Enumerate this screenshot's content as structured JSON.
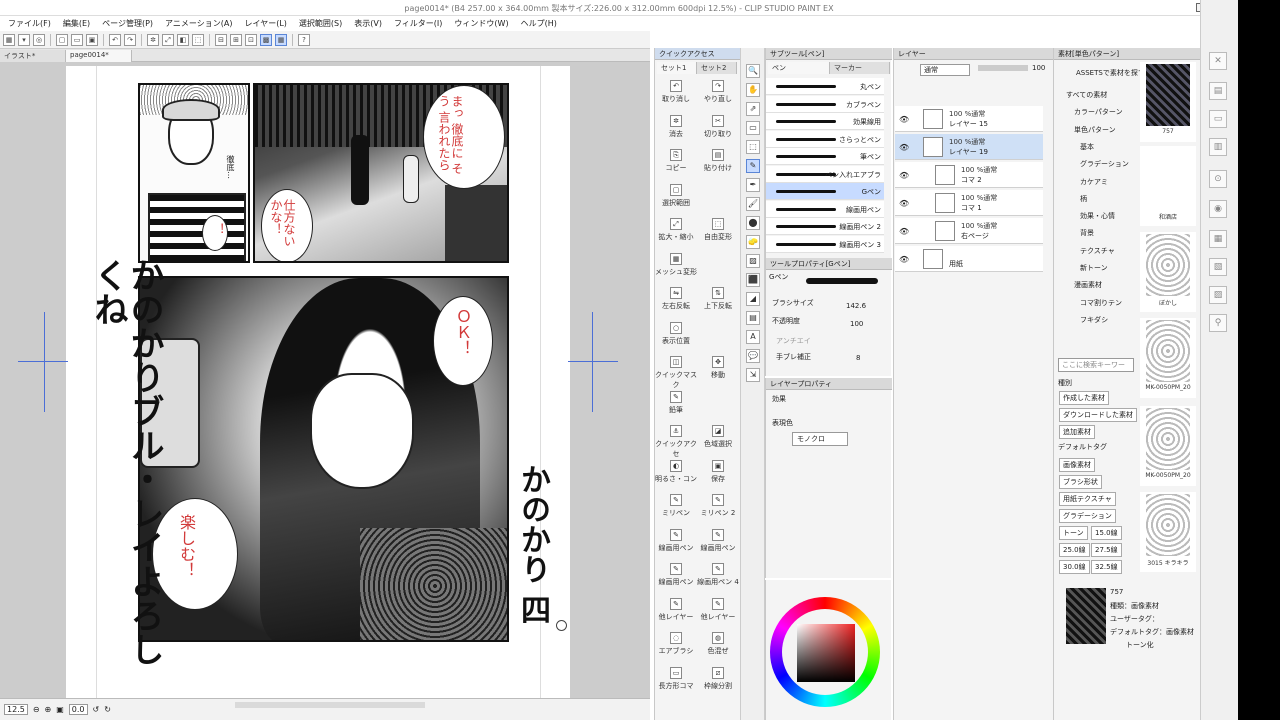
{
  "window": {
    "title": "page0014* (B4 257.00 x 364.00mm 製本サイズ:226.00 x 312.00mm 600dpi 12.5%) - CLIP STUDIO PAINT EX"
  },
  "menu": [
    "ファイル(F)",
    "編集(E)",
    "ページ管理(P)",
    "アニメーション(A)",
    "レイヤー(L)",
    "選択範囲(S)",
    "表示(V)",
    "フィルター(I)",
    "ウィンドウ(W)",
    "ヘルプ(H)"
  ],
  "tabs": [
    "イラスト*",
    "page0014*"
  ],
  "status": {
    "zoom": "12.5",
    "angle": "0.0"
  },
  "manga": {
    "bubble_top": "まっ 徹底に そう 言われたら",
    "bubble_top2": "仕方ない かな！",
    "bubble_small": "！",
    "bubble_ok": "ＯＫ！",
    "bubble_fun": "楽しむ！",
    "boy_text": "徹底…",
    "side_left": "かのかりブル・レイよろしくね",
    "side_right": "かのかり 四"
  },
  "quick_access": {
    "header": "クイックアクセス",
    "tabs": [
      "セット1",
      "セット2"
    ],
    "items": [
      {
        "label": "取り消し",
        "icon": "↶"
      },
      {
        "label": "やり直し",
        "icon": "↷"
      },
      {
        "label": "消去",
        "icon": "✲"
      },
      {
        "label": "切り取り",
        "icon": "✂"
      },
      {
        "label": "コピー",
        "icon": "⎘"
      },
      {
        "label": "貼り付け",
        "icon": "▤"
      },
      {
        "label": "選択範囲",
        "icon": "▢"
      },
      {
        "label": "",
        "icon": ""
      },
      {
        "label": "拡大・縮小",
        "icon": "⤢"
      },
      {
        "label": "自由変形",
        "icon": "⬚"
      },
      {
        "label": "メッシュ変形",
        "icon": "▦"
      },
      {
        "label": "",
        "icon": ""
      },
      {
        "label": "左右反転",
        "icon": "⇋"
      },
      {
        "label": "上下反転",
        "icon": "⇅"
      },
      {
        "label": "表示位置",
        "icon": "○"
      },
      {
        "label": "",
        "icon": ""
      },
      {
        "label": "クイックマスク",
        "icon": "◫"
      },
      {
        "label": "移動",
        "icon": "✥"
      },
      {
        "label": "鉛筆",
        "icon": "✎"
      },
      {
        "label": "",
        "icon": ""
      },
      {
        "label": "クイックアクセ",
        "icon": "⚓"
      },
      {
        "label": "色域選択",
        "icon": "◪"
      },
      {
        "label": "明るさ・コン",
        "icon": "◐"
      },
      {
        "label": "保存",
        "icon": "▣"
      },
      {
        "label": "ミリペン",
        "icon": "✎"
      },
      {
        "label": "ミリペン 2",
        "icon": "✎"
      },
      {
        "label": "線画用ペン",
        "icon": "✎"
      },
      {
        "label": "線画用ペン",
        "icon": "✎"
      },
      {
        "label": "線画用ペン",
        "icon": "✎"
      },
      {
        "label": "線画用ペン 4",
        "icon": "✎"
      },
      {
        "label": "他レイヤー",
        "icon": "✎"
      },
      {
        "label": "他レイヤー",
        "icon": "✎"
      },
      {
        "label": "エアブラシ",
        "icon": "◌"
      },
      {
        "label": "色混ぜ",
        "icon": "◍"
      },
      {
        "label": "長方形コマ",
        "icon": "▭"
      },
      {
        "label": "枠線分割",
        "icon": "⧄"
      }
    ]
  },
  "tools": [
    "🔍",
    "✋",
    "⇗",
    "▭",
    "⬚",
    "✎",
    "✒",
    "🖌",
    "⬤",
    "🧽",
    "▨",
    "⬛",
    "◢",
    "▤",
    "A",
    "💬",
    "⇲"
  ],
  "subtool": {
    "header": "サブツール[ペン]",
    "tabs": [
      "ペン",
      "マーカー"
    ],
    "items": [
      {
        "label": "丸ペン"
      },
      {
        "label": "カブラペン"
      },
      {
        "label": "効果線用"
      },
      {
        "label": "さらっとペン"
      },
      {
        "label": "筆ペン"
      },
      {
        "label": "ペン入れエアブラ"
      },
      {
        "label": "Gペン"
      },
      {
        "label": "線画用ペン"
      },
      {
        "label": "線画用ペン 2"
      },
      {
        "label": "線画用ペン 3"
      }
    ]
  },
  "tool_property": {
    "header": "ツールプロパティ[Gペン]",
    "name": "Gペン",
    "brush_size_label": "ブラシサイズ",
    "brush_size": "142.6",
    "opacity_label": "不透明度",
    "opacity": "100",
    "antialias_label": "アンチエイ",
    "stab_label": "手ブレ補正",
    "stab": "8"
  },
  "layer_property": {
    "header": "レイヤープロパティ",
    "effect_label": "効果",
    "color_label": "表現色",
    "color_value": "モノクロ"
  },
  "layers": {
    "header": "レイヤー",
    "blend": "通常",
    "opacity": "100",
    "items": [
      {
        "mode": "100 %通常",
        "name": "レイヤー 15"
      },
      {
        "mode": "100 %通常",
        "name": "レイヤー 19"
      },
      {
        "mode": "100 %通常",
        "name": "コマ 2"
      },
      {
        "mode": "100 %通常",
        "name": "コマ 1"
      },
      {
        "mode": "100 %通常",
        "name": "右ページ"
      },
      {
        "mode": "",
        "name": "用紙"
      }
    ]
  },
  "materials": {
    "header": "素材[単色パターン]",
    "search_header": "ASSETSで素材を探す",
    "tree": [
      "すべての素材",
      "カラーパターン",
      "単色パターン",
      "基本",
      "グラデーション",
      "カケアミ",
      "柄",
      "効果・心情",
      "背景",
      "テクスチャ",
      "新トーン",
      "漫画素材",
      "コマ割りテン",
      "フキダシ"
    ],
    "search_placeholder": "ここに検索キーワー",
    "tag_header": "種別",
    "tags": [
      "作成した素材",
      "ダウンロードした素材",
      "追加素材"
    ],
    "default_tag_header": "デフォルトタグ",
    "default_tags": [
      "画像素材",
      "ブラシ形状",
      "用紙テクスチャ",
      "グラデーション",
      "トーン",
      "15.0線",
      "25.0線",
      "27.5線",
      "30.0線",
      "32.5線"
    ],
    "thumbs": [
      "757",
      "和酒店",
      "ぼかし",
      "MK-0050PM_20",
      "MK-0050PM_20",
      "3015 キラキラ"
    ],
    "detail_title": "757",
    "detail_kind": "種類：画像素材",
    "detail_user": "ユーザータグ：",
    "detail_default": "デフォルトタグ：画像素材",
    "detail_tone": "トーン化"
  }
}
